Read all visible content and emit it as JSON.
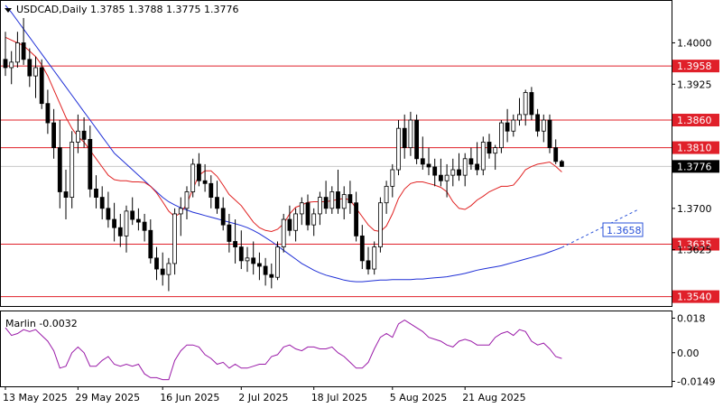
{
  "chart_data": [
    {
      "type": "candlestick",
      "symbol_line": "USDCAD,Daily  1.3785 1.3788 1.3775 1.3776",
      "current_price": {
        "value": 1.3776,
        "label": "1.3776"
      },
      "yrange": [
        1.3523,
        1.4076
      ],
      "ticks": [
        {
          "value": 1.4,
          "label": "1.4000"
        },
        {
          "value": 1.3925,
          "label": "1.3925"
        },
        {
          "value": 1.3775,
          "label": "1.3775"
        },
        {
          "value": 1.37,
          "label": "1.3700"
        },
        {
          "value": 1.3625,
          "label": "1.3625"
        }
      ],
      "levels": [
        {
          "value": 1.3958,
          "label": "1.3958"
        },
        {
          "value": 1.386,
          "label": "1.3860"
        },
        {
          "value": 1.381,
          "label": "1.3810"
        },
        {
          "value": 1.3635,
          "label": "1.3635"
        },
        {
          "value": 1.354,
          "label": "1.3540"
        }
      ],
      "projection": {
        "from": 1.3629,
        "to": 1.3697,
        "label": "1.3658"
      },
      "candles": [
        [
          1.397,
          1.402,
          1.394,
          1.3955
        ],
        [
          1.3955,
          1.3985,
          1.3925,
          1.3965
        ],
        [
          1.3965,
          1.402,
          1.3955,
          1.4
        ],
        [
          1.4,
          1.4045,
          1.396,
          1.397
        ],
        [
          1.397,
          1.399,
          1.392,
          1.394
        ],
        [
          1.394,
          1.3975,
          1.39,
          1.3955
        ],
        [
          1.3955,
          1.397,
          1.388,
          1.389
        ],
        [
          1.389,
          1.3915,
          1.3835,
          1.3855
        ],
        [
          1.3855,
          1.388,
          1.379,
          1.381
        ],
        [
          1.381,
          1.386,
          1.37,
          1.373
        ],
        [
          1.373,
          1.377,
          1.368,
          1.372
        ],
        [
          1.372,
          1.384,
          1.37,
          1.382
        ],
        [
          1.382,
          1.387,
          1.38,
          1.384
        ],
        [
          1.384,
          1.3865,
          1.381,
          1.3825
        ],
        [
          1.3825,
          1.385,
          1.372,
          1.3735
        ],
        [
          1.3735,
          1.376,
          1.37,
          1.372
        ],
        [
          1.372,
          1.374,
          1.368,
          1.37
        ],
        [
          1.37,
          1.373,
          1.3665,
          1.368
        ],
        [
          1.368,
          1.371,
          1.364,
          1.3665
        ],
        [
          1.3665,
          1.369,
          1.363,
          1.365
        ],
        [
          1.365,
          1.3705,
          1.362,
          1.3695
        ],
        [
          1.3695,
          1.372,
          1.367,
          1.368
        ],
        [
          1.368,
          1.37,
          1.366,
          1.3675
        ],
        [
          1.3675,
          1.369,
          1.364,
          1.366
        ],
        [
          1.366,
          1.368,
          1.36,
          1.361
        ],
        [
          1.361,
          1.363,
          1.357,
          1.359
        ],
        [
          1.359,
          1.362,
          1.356,
          1.358
        ],
        [
          1.358,
          1.361,
          1.355,
          1.36
        ],
        [
          1.36,
          1.37,
          1.358,
          1.369
        ],
        [
          1.369,
          1.372,
          1.365,
          1.37
        ],
        [
          1.37,
          1.374,
          1.368,
          1.373
        ],
        [
          1.373,
          1.379,
          1.372,
          1.378
        ],
        [
          1.378,
          1.38,
          1.374,
          1.375
        ],
        [
          1.375,
          1.378,
          1.373,
          1.3745
        ],
        [
          1.3745,
          1.376,
          1.37,
          1.372
        ],
        [
          1.372,
          1.375,
          1.369,
          1.37
        ],
        [
          1.37,
          1.372,
          1.366,
          1.367
        ],
        [
          1.367,
          1.369,
          1.362,
          1.364
        ],
        [
          1.364,
          1.368,
          1.36,
          1.363
        ],
        [
          1.363,
          1.366,
          1.359,
          1.3605
        ],
        [
          1.3605,
          1.363,
          1.3585,
          1.361
        ],
        [
          1.361,
          1.364,
          1.358,
          1.36
        ],
        [
          1.36,
          1.362,
          1.357,
          1.3595
        ],
        [
          1.3595,
          1.361,
          1.356,
          1.358
        ],
        [
          1.358,
          1.36,
          1.3555,
          1.3575
        ],
        [
          1.3575,
          1.364,
          1.357,
          1.363
        ],
        [
          1.363,
          1.369,
          1.362,
          1.368
        ],
        [
          1.368,
          1.3705,
          1.365,
          1.366
        ],
        [
          1.366,
          1.37,
          1.364,
          1.369
        ],
        [
          1.369,
          1.372,
          1.367,
          1.371
        ],
        [
          1.371,
          1.3725,
          1.366,
          1.367
        ],
        [
          1.367,
          1.37,
          1.365,
          1.369
        ],
        [
          1.369,
          1.373,
          1.367,
          1.372
        ],
        [
          1.372,
          1.375,
          1.369,
          1.37
        ],
        [
          1.37,
          1.374,
          1.369,
          1.373
        ],
        [
          1.373,
          1.377,
          1.369,
          1.37
        ],
        [
          1.37,
          1.374,
          1.368,
          1.3725
        ],
        [
          1.3725,
          1.375,
          1.369,
          1.371
        ],
        [
          1.371,
          1.373,
          1.364,
          1.365
        ],
        [
          1.365,
          1.367,
          1.359,
          1.3605
        ],
        [
          1.3605,
          1.363,
          1.358,
          1.359
        ],
        [
          1.359,
          1.364,
          1.358,
          1.363
        ],
        [
          1.363,
          1.372,
          1.362,
          1.371
        ],
        [
          1.371,
          1.375,
          1.369,
          1.374
        ],
        [
          1.374,
          1.378,
          1.372,
          1.377
        ],
        [
          1.377,
          1.386,
          1.376,
          1.3845
        ],
        [
          1.3845,
          1.387,
          1.379,
          1.381
        ],
        [
          1.381,
          1.3875,
          1.3795,
          1.386
        ],
        [
          1.386,
          1.387,
          1.378,
          1.379
        ],
        [
          1.379,
          1.383,
          1.377,
          1.378
        ],
        [
          1.378,
          1.381,
          1.376,
          1.3775
        ],
        [
          1.3775,
          1.379,
          1.374,
          1.376
        ],
        [
          1.376,
          1.379,
          1.374,
          1.375
        ],
        [
          1.375,
          1.378,
          1.372,
          1.376
        ],
        [
          1.376,
          1.379,
          1.374,
          1.377
        ],
        [
          1.377,
          1.38,
          1.375,
          1.376
        ],
        [
          1.376,
          1.38,
          1.374,
          1.379
        ],
        [
          1.379,
          1.381,
          1.377,
          1.378
        ],
        [
          1.378,
          1.382,
          1.376,
          1.377
        ],
        [
          1.377,
          1.383,
          1.376,
          1.382
        ],
        [
          1.382,
          1.3835,
          1.379,
          1.38
        ],
        [
          1.38,
          1.3815,
          1.377,
          1.381
        ],
        [
          1.381,
          1.386,
          1.38,
          1.3855
        ],
        [
          1.3855,
          1.388,
          1.382,
          1.384
        ],
        [
          1.384,
          1.387,
          1.383,
          1.386
        ],
        [
          1.386,
          1.39,
          1.385,
          1.387
        ],
        [
          1.387,
          1.3915,
          1.385,
          1.391
        ],
        [
          1.391,
          1.392,
          1.386,
          1.387
        ],
        [
          1.387,
          1.388,
          1.383,
          1.384
        ],
        [
          1.384,
          1.387,
          1.382,
          1.386
        ],
        [
          1.386,
          1.387,
          1.38,
          1.381
        ],
        [
          1.381,
          1.3825,
          1.378,
          1.3785
        ],
        [
          1.3785,
          1.3788,
          1.3775,
          1.3776
        ]
      ],
      "ma_red": [
        1.401,
        1.4005,
        1.4,
        1.3995,
        1.3985,
        1.3975,
        1.396,
        1.394,
        1.3915,
        1.389,
        1.3865,
        1.3845,
        1.383,
        1.382,
        1.3805,
        1.379,
        1.3775,
        1.376,
        1.3752,
        1.375,
        1.375,
        1.3748,
        1.3748,
        1.3747,
        1.374,
        1.3728,
        1.3712,
        1.3695,
        1.3685,
        1.3692,
        1.3708,
        1.3735,
        1.376,
        1.3768,
        1.3768,
        1.3758,
        1.3742,
        1.3725,
        1.3715,
        1.3705,
        1.369,
        1.3675,
        1.3665,
        1.366,
        1.3658,
        1.3662,
        1.3672,
        1.369,
        1.3702,
        1.3706,
        1.3711,
        1.3712,
        1.3712,
        1.3712,
        1.3714,
        1.3716,
        1.3718,
        1.3715,
        1.37,
        1.3685,
        1.367,
        1.366,
        1.3658,
        1.3668,
        1.369,
        1.3718,
        1.3735,
        1.3745,
        1.3748,
        1.3748,
        1.3745,
        1.3742,
        1.3738,
        1.373,
        1.3712,
        1.37,
        1.3698,
        1.3705,
        1.3715,
        1.3722,
        1.373,
        1.3735,
        1.374,
        1.374,
        1.3742,
        1.3755,
        1.377,
        1.3776,
        1.378,
        1.3782,
        1.3784,
        1.3776,
        1.3766
      ],
      "ma_blue": [
        1.4068,
        1.4055,
        1.404,
        1.4025,
        1.401,
        1.3995,
        1.398,
        1.3965,
        1.395,
        1.3935,
        1.392,
        1.3905,
        1.389,
        1.3875,
        1.386,
        1.3845,
        1.383,
        1.3815,
        1.38,
        1.379,
        1.378,
        1.377,
        1.376,
        1.375,
        1.374,
        1.373,
        1.372,
        1.3712,
        1.3706,
        1.3701,
        1.3697,
        1.3693,
        1.369,
        1.3687,
        1.3684,
        1.3681,
        1.3678,
        1.3675,
        1.3672,
        1.3669,
        1.3665,
        1.366,
        1.3654,
        1.3647,
        1.364,
        1.3632,
        1.3624,
        1.3616,
        1.3608,
        1.36,
        1.3594,
        1.3588,
        1.3583,
        1.3579,
        1.3576,
        1.3573,
        1.357,
        1.3568,
        1.3567,
        1.3567,
        1.3568,
        1.3569,
        1.357,
        1.357,
        1.3571,
        1.3571,
        1.3571,
        1.3571,
        1.3572,
        1.3572,
        1.3573,
        1.3574,
        1.3575,
        1.3576,
        1.3578,
        1.358,
        1.3582,
        1.3585,
        1.3588,
        1.359,
        1.3592,
        1.3594,
        1.3596,
        1.3599,
        1.3602,
        1.3605,
        1.3608,
        1.3611,
        1.3614,
        1.3617,
        1.3621,
        1.3625,
        1.3629
      ]
    },
    {
      "type": "line",
      "indicator_label": "Marlin -0.0032",
      "yrange": [
        -0.0175,
        0.0215
      ],
      "ticks": [
        {
          "value": 0.018,
          "label": "0.018"
        },
        {
          "value": 0.0,
          "label": "0.00"
        },
        {
          "value": -0.0149,
          "label": "-0.0149"
        }
      ],
      "values": [
        0.013,
        0.009,
        0.01,
        0.012,
        0.011,
        0.012,
        0.009,
        0.006,
        0.001,
        -0.008,
        -0.007,
        0.0,
        0.003,
        0.0,
        -0.007,
        -0.007,
        -0.004,
        -0.002,
        -0.006,
        -0.007,
        -0.006,
        -0.007,
        -0.006,
        -0.011,
        -0.013,
        -0.013,
        -0.014,
        -0.014,
        -0.004,
        0.001,
        0.004,
        0.004,
        0.003,
        -0.001,
        -0.003,
        -0.006,
        -0.005,
        -0.008,
        -0.006,
        -0.008,
        -0.008,
        -0.007,
        -0.006,
        -0.006,
        -0.002,
        -0.001,
        0.003,
        0.004,
        0.002,
        0.001,
        0.003,
        0.003,
        0.002,
        0.002,
        0.003,
        0.0,
        -0.002,
        -0.005,
        -0.008,
        -0.008,
        -0.005,
        0.002,
        0.008,
        0.01,
        0.008,
        0.015,
        0.017,
        0.015,
        0.013,
        0.011,
        0.008,
        0.007,
        0.006,
        0.004,
        0.003,
        0.006,
        0.007,
        0.006,
        0.004,
        0.004,
        0.004,
        0.008,
        0.01,
        0.011,
        0.009,
        0.012,
        0.011,
        0.006,
        0.004,
        0.005,
        0.002,
        -0.002,
        -0.003
      ]
    }
  ],
  "x_axis": {
    "date_labels": [
      {
        "bar": 0,
        "label": "13 May 2025"
      },
      {
        "bar": 12,
        "label": "29 May 2025"
      },
      {
        "bar": 26,
        "label": "16 Jun 2025"
      },
      {
        "bar": 39,
        "label": "2 Jul 2025"
      },
      {
        "bar": 51,
        "label": "18 Jul 2025"
      },
      {
        "bar": 64,
        "label": "5 Aug 2025"
      },
      {
        "bar": 76,
        "label": "21 Aug 2025"
      }
    ]
  },
  "colors": {
    "bull": "#ffffff",
    "bear": "#000000",
    "ma_red": "#e02020",
    "ma_blue": "#1f2fd6",
    "level_line": "#e0202a",
    "level_badge": "#e0202a",
    "current_badge": "#000000",
    "projection": "#2a52d8",
    "oscillator": "#9a1aa8"
  }
}
